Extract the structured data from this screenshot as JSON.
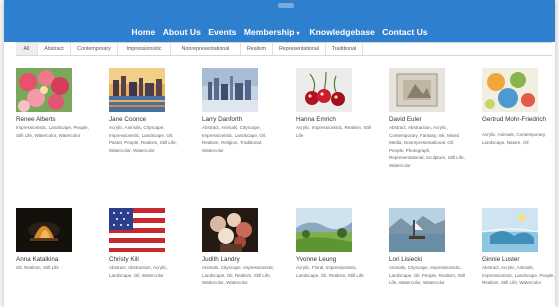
{
  "nav": {
    "items": [
      "Home",
      "About Us",
      "Events",
      "Membership",
      "Knowledgebase",
      "Contact Us"
    ],
    "membership_caret": "▾"
  },
  "filters": [
    "All",
    "Abstract",
    "Contemporary",
    "Impressionistic",
    "Nonrepresentational",
    "Realism",
    "Representational",
    "Traditional"
  ],
  "artists": [
    {
      "name": "Renee Alberts",
      "tags": "Impressionistic, Landscape, People, Still Life, Watercolor, Watercolor"
    },
    {
      "name": "Jane Coonce",
      "tags": "Acrylic, Animals, Cityscape, Impressionistic, Landscape, Oil, Pastel, People, Realism, Still Life, Watercolor, Watercolor"
    },
    {
      "name": "Larry Danforth",
      "tags": "Abstract, Animals, Cityscape, Impressionistic, Landscape, Oil, Realism, Religion, Traditional, Watercolor"
    },
    {
      "name": "Hanna Emrich",
      "tags": "Acrylic, Impressionistic, Realism, Still Life"
    },
    {
      "name": "David Euler",
      "tags": "Abstract, Abstraction, Acrylic, Contemporary, Fantasy, Ink, Mixed Media, Nonrepresentational, Oil, People, Photograph, Representational, Sculpture, Still Life, Watercolor"
    },
    {
      "name": "Gertrud Mohr-Friedrich",
      "tags": "Acrylic, Animals, Contemporary, Landscape, Nature, Oil"
    },
    {
      "name": "Anna Katalkina",
      "tags": "Oil, Realism, Still Life"
    },
    {
      "name": "Christy Kill",
      "tags": "Abstract, Abstraction, Acrylic, Landscape, Oil, Watercolor"
    },
    {
      "name": "Judith Landry",
      "tags": "Animals, Cityscape, Impressionistic, Landscape, Oil, Realism, Still Life, Watercolor, Watercolor"
    },
    {
      "name": "Yvonne Leung",
      "tags": "Acrylic, Floral, Impressionistic, Landscape, Oil, Realism, Still Life"
    },
    {
      "name": "Lori Lisiecki",
      "tags": "Animals, Cityscape, Impressionistic, Landscape, Oil, People, Realism, Still Life, Watercolor, Watercolor"
    },
    {
      "name": "Ginnie Luster",
      "tags": "Abstract, Acrylic, Animals, Impressionistic, Landscape, People, Realism, Still Life, Watercolor"
    }
  ]
}
